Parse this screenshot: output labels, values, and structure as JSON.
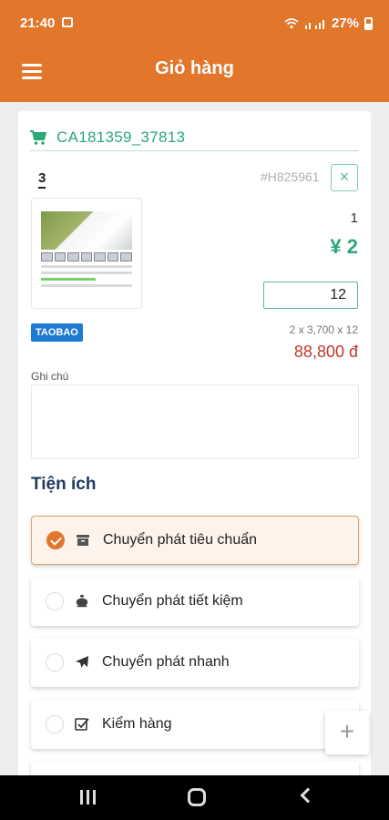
{
  "status_bar": {
    "time": "21:40",
    "battery": "27%"
  },
  "app_bar": {
    "title": "Giỏ hàng"
  },
  "cart": {
    "code": "CA181359_37813",
    "item": {
      "index": "3",
      "order_id": "#H825961",
      "remove_symbol": "×",
      "count": "1",
      "unit_price": "¥ 2",
      "quantity": "12",
      "source_badge": "TAOBAO",
      "calculation": "2 x 3,700 x 12",
      "total": "88,800 đ"
    },
    "note_label": "Ghi chú",
    "note_value": ""
  },
  "services": {
    "title": "Tiện ích",
    "options": [
      {
        "label": "Chuyển phát tiêu chuẩn",
        "icon": "box-icon",
        "selected": true
      },
      {
        "label": "Chuyển phát tiết kiệm",
        "icon": "piggy-bank-icon",
        "selected": false
      },
      {
        "label": "Chuyển phát nhanh",
        "icon": "airplane-icon",
        "selected": false
      },
      {
        "label": "Kiểm hàng",
        "icon": "check-square-icon",
        "selected": false
      }
    ]
  },
  "fab": {
    "symbol": "+"
  },
  "colors": {
    "primary": "#e2762a",
    "accent_green": "#2aa876",
    "price_red": "#c0392b",
    "badge_blue": "#1f7ad4",
    "title_navy": "#1e3a5f"
  }
}
